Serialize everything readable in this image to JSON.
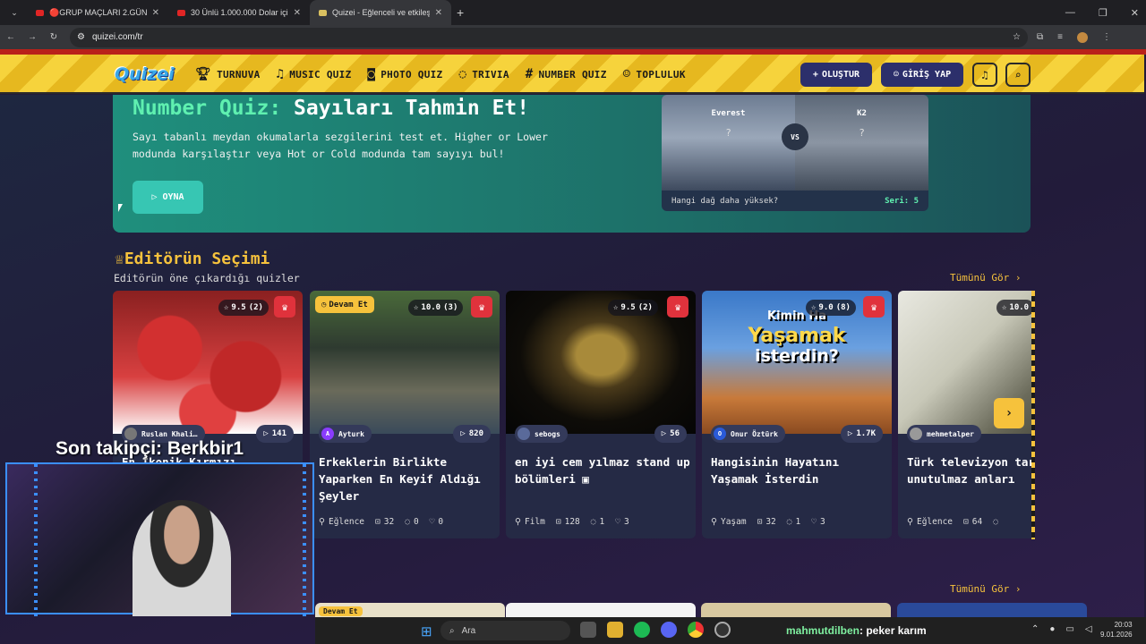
{
  "browser": {
    "tabs": [
      {
        "title": "🔴GRUP MAÇLARI 2.GÜN l Go",
        "active": false
      },
      {
        "title": "30 Ünlü 1.000.000 Dolar için Ya",
        "active": false
      },
      {
        "title": "Quizei - Eğlenceli ve etkileşimli",
        "active": true
      }
    ],
    "new_tab": "+",
    "url": "quizei.com/tr"
  },
  "site": {
    "logo": "Quizei",
    "nav": [
      {
        "label": "TURNUVA",
        "icon": "trophy-icon"
      },
      {
        "label": "MUSIC QUIZ",
        "icon": "music-icon"
      },
      {
        "label": "PHOTO QUIZ",
        "icon": "camera-icon"
      },
      {
        "label": "TRIVIA",
        "icon": "chat-icon"
      },
      {
        "label": "NUMBER QUIZ",
        "icon": "hash-icon"
      },
      {
        "label": "TOPLULUK",
        "icon": "users-icon"
      }
    ],
    "create_label": "OLUŞTUR",
    "login_label": "GİRİŞ YAP"
  },
  "hero": {
    "title_accent": "Number Quiz:",
    "title_rest": "Sayıları Tahmin Et!",
    "description": "Sayı tabanlı meydan okumalarla sezgilerini test et. Higher or Lower modunda karşılaştır veya Hot or Cold modunda tam sayıyı bul!",
    "play_label": "OYNA",
    "card": {
      "left_name": "Everest",
      "right_name": "K2",
      "unknown": "?",
      "vs": "VS",
      "question": "Hangi dağ daha yüksek?",
      "streak": "Seri: 5"
    }
  },
  "editors_pick": {
    "title": "Editörün Seçimi",
    "subtitle": "Editörün öne çıkardığı quizler",
    "see_all": "Tümünü Gör",
    "cards": [
      {
        "rating": "9.5",
        "count": "(2)",
        "author": "Ruslan Khali…",
        "plays": "141",
        "title": "En İkonik Kırmızı",
        "category": "",
        "questions": "",
        "comments": "",
        "likes": "",
        "continue": ""
      },
      {
        "rating": "10.0",
        "count": "(3)",
        "author": "Ayturk",
        "plays": "820",
        "title": "Erkeklerin Birlikte Yaparken En Keyif Aldığı Şeyler",
        "category": "Eğlence",
        "questions": "32",
        "comments": "0",
        "likes": "0",
        "continue": "Devam Et"
      },
      {
        "rating": "9.5",
        "count": "(2)",
        "author": "sebogs",
        "plays": "56",
        "title": "en iyi cem yılmaz stand up bölümleri",
        "category": "Film",
        "questions": "128",
        "comments": "1",
        "likes": "3",
        "continue": ""
      },
      {
        "rating": "9.0",
        "count": "(8)",
        "author": "Onur Öztürk",
        "plays": "1.7K",
        "title": "Hangisinin Hayatını Yaşamak İsterdin",
        "category": "Yaşam",
        "questions": "32",
        "comments": "1",
        "likes": "3",
        "continue": ""
      },
      {
        "rating": "10.0",
        "count": "",
        "author": "mehmetalper",
        "plays": "",
        "title": "Türk televizyon tarihinin unutulmaz anları",
        "category": "Eğlence",
        "questions": "64",
        "comments": "",
        "likes": "",
        "continue": ""
      }
    ],
    "thumb_text": {
      "kimin": "Kimin Ha",
      "yasamak": "Yaşamak",
      "isterdin": "isterdin?"
    }
  },
  "second_section": {
    "see_all": "Tümünü Gör",
    "continue": "Devam Et"
  },
  "stream": {
    "follower_text": "Son takipçi: Berkbir1",
    "chat_user": "mahmutdilben",
    "chat_message": ": peker karım"
  },
  "taskbar": {
    "search": "Ara",
    "time": "20:03",
    "date": "9.01.2026"
  },
  "colors": {
    "accent": "#f6c23c",
    "teal": "#1f8f7d",
    "brand_blue": "#2c2f6b",
    "crown_red": "#e0323c"
  }
}
